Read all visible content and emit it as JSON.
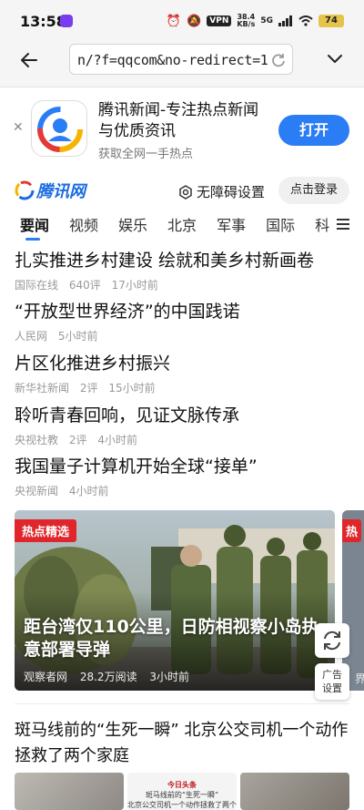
{
  "status_bar": {
    "time": "13:58",
    "vpn": "VPN",
    "speed_value": "38.4",
    "speed_unit": "KB/s",
    "network": "5G",
    "battery": "74"
  },
  "browser": {
    "url": "n/?f=qqcom&no-redirect=1"
  },
  "app_banner": {
    "title": "腾讯新闻-专注热点新闻与优质资讯",
    "subtitle": "获取全网一手热点",
    "open_label": "打开"
  },
  "site_header": {
    "logo_text": "腾讯网",
    "accessibility_label": "无障碍设置",
    "login_label": "点击登录"
  },
  "nav": {
    "tabs": [
      "要闻",
      "视频",
      "娱乐",
      "北京",
      "军事",
      "国际",
      "科"
    ]
  },
  "headlines": [
    {
      "title": "扎实推进乡村建设 绘就和美乡村新画卷",
      "source": "国际在线",
      "comments": "640评",
      "time": "17小时前"
    },
    {
      "title": "“开放型世界经济”的中国践诺",
      "source": "人民网",
      "comments": "",
      "time": "5小时前"
    },
    {
      "title": "片区化推进乡村振兴",
      "source": "新华社新闻",
      "comments": "2评",
      "time": "15小时前"
    },
    {
      "title": "聆听青春回响，见证文脉传承",
      "source": "央视社教",
      "comments": "2评",
      "time": "4小时前"
    },
    {
      "title": "我国量子计算机开始全球“接单”",
      "source": "央视新闻",
      "comments": "",
      "time": "4小时前"
    }
  ],
  "feature": {
    "tag": "热点精选",
    "title": "距台湾仅110公里，日防相视察小岛执意部署导弹",
    "source": "观察者网",
    "reads": "28.2万阅读",
    "time": "3小时前",
    "next_tag": "热",
    "next_meta": "界"
  },
  "floating": {
    "ad_settings_line1": "广告",
    "ad_settings_line2": "设置"
  },
  "story2": {
    "title": "斑马线前的“生死一瞬” 北京公交司机一个动作拯救了两个家庭",
    "thumb_brand": "今日头条",
    "thumb_line1": "斑马线前的“生死一瞬”",
    "thumb_line2": "北京公交司机一个动作拯救了两个家庭"
  },
  "colors": {
    "accent": "#2a7df5",
    "tag_red": "#e0262b",
    "meta_gray": "#999999"
  }
}
